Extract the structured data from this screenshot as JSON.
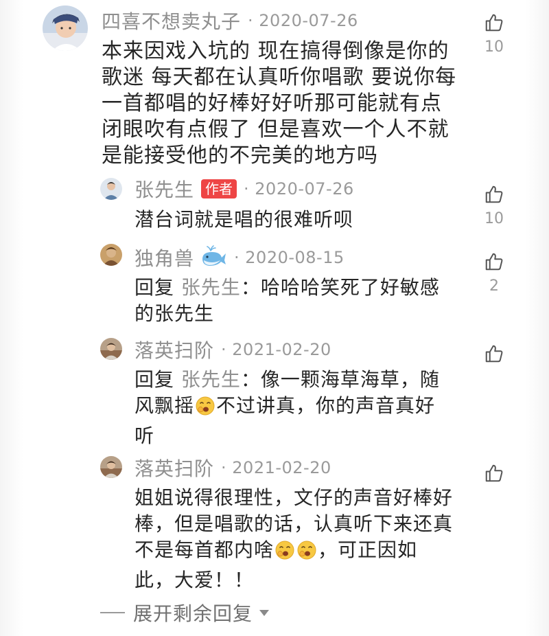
{
  "comments": [
    {
      "username": "四喜不想卖丸子",
      "date": "· 2020-07-26",
      "lines": [
        "本来因戏入坑的 现在搞得倒像是你的",
        "歌迷 每天都在认真听你唱歌 要说你每",
        "一首都唱的好棒好好听那可能就有点",
        "闭眼吹有点假了 但是喜欢一个人不就",
        "是能接受他的不完美的地方吗"
      ],
      "likes": "10"
    }
  ],
  "replies": [
    {
      "username": "张先生",
      "badge": "作者",
      "date": "· 2020-07-26",
      "text": "潜台词就是唱的很难听呗",
      "likes": "10"
    },
    {
      "username": "独角兽",
      "date": "· 2020-08-15",
      "reply_prefix": "回复 ",
      "reply_target": "张先生",
      "line1_rest": "：哈哈哈笑死了好敏感",
      "line2": "的张先生",
      "likes": "2"
    },
    {
      "username": "落英扫阶",
      "date": "· 2021-02-20",
      "reply_prefix": "回复 ",
      "reply_target": "张先生",
      "line1_rest": "：像一颗海草海草，随",
      "line2_a": "风飘摇",
      "line2_b": "不过讲真，你的声音真好",
      "line3": "听"
    },
    {
      "username": "落英扫阶",
      "date": "· 2021-02-20",
      "line1": "姐姐说得很理性，文仔的声音好棒好",
      "line2": "棒，但是唱歌的话，认真听下来还真",
      "line3_a": "不是每首都内啥",
      "line3_b": "，可正因如",
      "line4": "此，大爱！！"
    }
  ],
  "expand": {
    "label": "展开剩余回复"
  },
  "colors": {
    "username": "#8f8f8f",
    "badge_bg": "#ee4545",
    "text": "#262626",
    "meta": "#9a9a9a"
  },
  "icons": {
    "like": "thumbs-up-icon",
    "emoji": "yawning-face-emoji",
    "whale": "whale-emoji",
    "caret": "caret-down-icon"
  }
}
